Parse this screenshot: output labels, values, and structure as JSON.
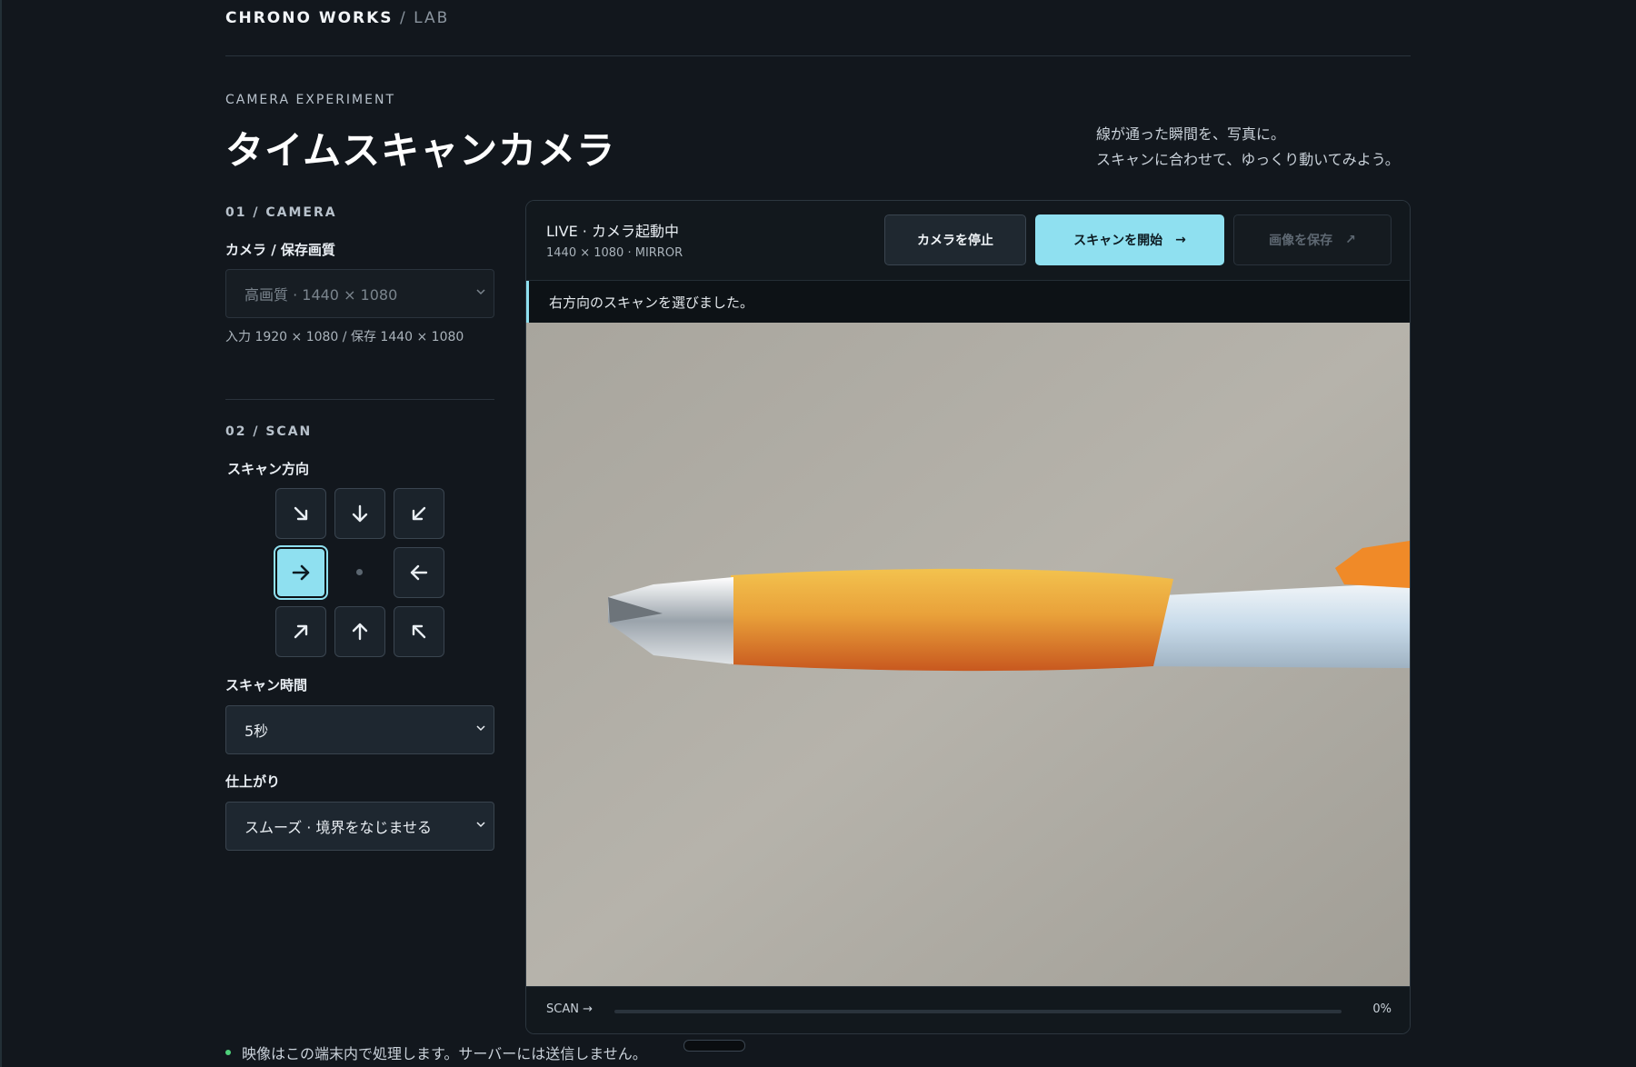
{
  "header": {
    "brand": "CHRONO WORKS",
    "separator": " / ",
    "section": "LAB"
  },
  "hero": {
    "eyebrow": "CAMERA EXPERIMENT",
    "title": "タイムスキャンカメラ",
    "tagline_line1": "線が通った瞬間を、写真に。",
    "tagline_line2": "スキャンに合わせて、ゆっくり動いてみよう。"
  },
  "camera_section": {
    "label": "01 / CAMERA",
    "field_label": "カメラ / 保存画質",
    "select_value": "高画質 · 1440 × 1080",
    "hint": "入力 1920 × 1080 / 保存 1440 × 1080"
  },
  "scan_section": {
    "label": "02 / SCAN",
    "direction_label": "スキャン方向",
    "directions": [
      "down-right",
      "down",
      "down-left",
      "right",
      "left",
      "up-right",
      "up",
      "up-left"
    ],
    "selected_direction": "right",
    "duration_label": "スキャン時間",
    "duration_value": "5秒",
    "finish_label": "仕上がり",
    "finish_value": "スムーズ · 境界をなじませる"
  },
  "preview": {
    "live_status": "LIVE · カメラ起動中",
    "live_meta": "1440 × 1080 · MIRROR",
    "stop_button": "カメラを停止",
    "start_button": "スキャンを開始",
    "save_button": "画像を保存",
    "notice": "右方向のスキャンを選びました。",
    "scan_label": "SCAN →",
    "progress_percent": 0,
    "progress_text": "0%"
  },
  "footer": {
    "note": "映像はこの端末内で処理します。サーバーには送信しません。"
  },
  "colors": {
    "background": "#12171d",
    "accent": "#8fe0f0",
    "status_dot": "#4ed17a"
  }
}
